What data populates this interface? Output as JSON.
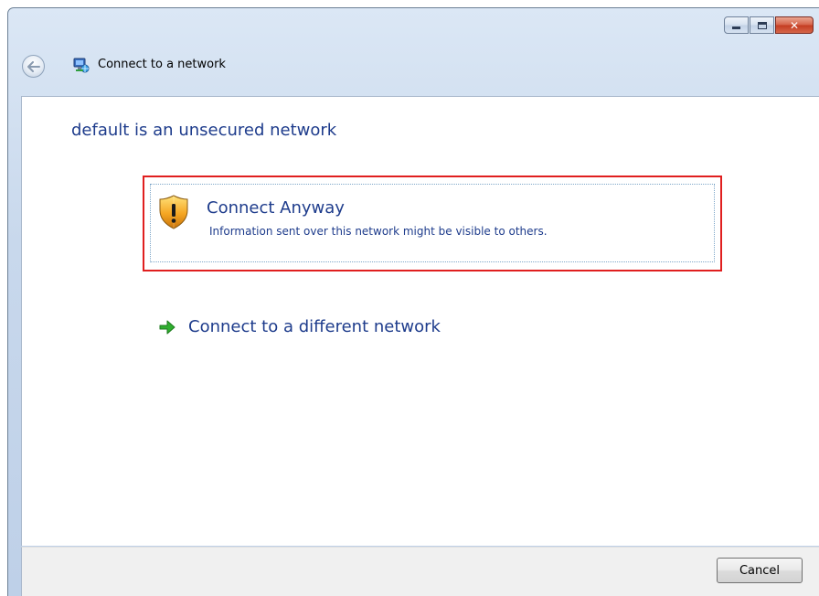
{
  "window": {
    "title": "Connect to a network",
    "caption_buttons": {
      "minimize": "minimize",
      "maximize": "maximize",
      "close": "close"
    }
  },
  "page": {
    "heading": "default is an unsecured network",
    "options": [
      {
        "title": "Connect Anyway",
        "description": "Information sent over this network might be visible to others.",
        "icon": "shield-warning-icon",
        "highlight_color": "#e01f1f"
      }
    ],
    "secondary_link": {
      "label": "Connect to a different network",
      "icon": "green-arrow-icon"
    }
  },
  "footer": {
    "cancel_label": "Cancel"
  },
  "colors": {
    "link_text": "#1e3c8c",
    "highlight": "#e01f1f",
    "arrow": "#2fae2f"
  }
}
